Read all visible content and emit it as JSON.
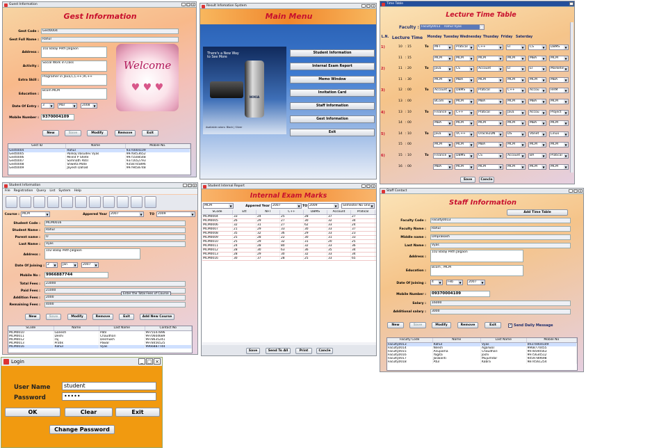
{
  "guest": {
    "window_title": "Guest Information",
    "title": "Gest Information",
    "labels": {
      "code": "Gest Code :",
      "name": "Gest Full Name :",
      "address": "Address :",
      "activity": "Activity :",
      "extra_skill": "Extra Skill :",
      "education": "Education :",
      "date_of_entry": "Date Of Entry :",
      "mobile": "Mobile Number :"
    },
    "values": {
      "code": "Gest0004",
      "name": "Rahul",
      "address": "102 Balaji Peth Jalgaon",
      "activity": "Social Work in Class",
      "extra_skill": "Programer in Java,C,C++,VC++",
      "education": "Bcom MCM",
      "day": "3",
      "month": "Mar",
      "year": "2008",
      "mobile": "9370004109"
    },
    "welcome_text": "Welcome",
    "buttons": {
      "new": "New",
      "save": "Save",
      "modify": "Modify",
      "remove": "Remove",
      "exit": "Exit"
    },
    "table": {
      "headers": [
        "Gest ID",
        "Name",
        "Mobile No."
      ],
      "rows": [
        [
          "Gest0004",
          "Rahul",
          "9370004109"
        ],
        [
          "Gest0005",
          "Pankaj Vasudev Vyas",
          "9976453652"
        ],
        [
          "Gest0006",
          "Milind P Shete",
          "9975508548"
        ],
        [
          "Gest0007",
          "Somnath Patil",
          "9371652793"
        ],
        [
          "Gest0008",
          "Shweta Mote",
          "9358745896"
        ],
        [
          "Gest0009",
          "Jayesh Dahad",
          "9979458748"
        ]
      ]
    }
  },
  "main_menu": {
    "window_title": "Result Infomation System",
    "title": "Main Menu",
    "phone_tagline": "There's a New Way\nto See More",
    "phone_caption": "Available colors: Black | Silver",
    "phone_brand": "NOKIA",
    "items": [
      "Student Information",
      "Internal Exam Report",
      "Memo Window",
      "Invitation Card",
      "Staff Information",
      "Gest Information",
      "Exit"
    ]
  },
  "timetable": {
    "window_title": "Time Table",
    "title": "Lecture Time Table",
    "faculty_label": "Faculty :",
    "faculty_value": "Faculty0013",
    "faculty_name": "Rahul Vyas",
    "headers": [
      "L.N.",
      "Lecture Time",
      "Monday",
      "Tuesday",
      "Wednesday",
      "Thusday",
      "Friday",
      "Saterday"
    ],
    "to": "To",
    "rows": [
      {
        "ln": "1)",
        "h": "10",
        "m": "15",
        "cells": [
          "MFT",
          "Pratical",
          "C++",
          "EI",
          "CS",
          "DBMS"
        ]
      },
      {
        "ln": "",
        "h": "11",
        "m": "15",
        "cells": [
          "MCM",
          "MCM",
          "MCM",
          "MCM",
          "MBA",
          "MCM"
        ]
      },
      {
        "ln": "2)",
        "h": "11",
        "m": "20",
        "cells": [
          "Java",
          "CS",
          "Account",
          "EI",
          "EI",
          "Marketing"
        ]
      },
      {
        "ln": "",
        "h": "11",
        "m": "30",
        "cells": [
          "MCM",
          "MBA",
          "MCM",
          "MCM",
          "MCM",
          "MBA"
        ]
      },
      {
        "ln": "3)",
        "h": "12",
        "m": "00",
        "cells": [
          "Account",
          "DBMS",
          "Pratical",
          "C++",
          "Accou",
          "HRM"
        ]
      },
      {
        "ln": "",
        "h": "13",
        "m": "00",
        "cells": [
          "BCom",
          "MCM",
          "MBA",
          "MCM",
          "MBA",
          "MCM"
        ]
      },
      {
        "ln": "4)",
        "h": "13",
        "m": "10",
        "cells": [
          "Finance",
          "C++",
          "Pratical",
          "Java",
          "Accou",
          "Project"
        ]
      },
      {
        "ln": "",
        "h": "14",
        "m": "00",
        "cells": [
          "MBA",
          "MCM",
          "MCM",
          "MCM",
          "MBA",
          "MCM"
        ]
      },
      {
        "ln": "5)",
        "h": "14",
        "m": "10",
        "cells": [
          "Java",
          "VC++",
          "Oracle2DN",
          "DS",
          "Vbnet",
          "Linux"
        ]
      },
      {
        "ln": "",
        "h": "15",
        "m": "00",
        "cells": [
          "MCM",
          "MCM",
          "MBA",
          "MCM",
          "MCM",
          "MCM"
        ]
      },
      {
        "ln": "6)",
        "h": "15",
        "m": "10",
        "cells": [
          "Finance",
          "DBMS",
          "CS",
          "Account",
          "BA",
          "Pratical"
        ]
      },
      {
        "ln": "",
        "h": "16",
        "m": "00",
        "cells": [
          "MBA",
          "MCM",
          "MCM",
          "MCM",
          "MCM",
          "MCM"
        ]
      }
    ],
    "buttons": {
      "save": "Save",
      "cancel": "Cancle"
    }
  },
  "student": {
    "window_title": "Student Information",
    "menu": [
      "File",
      "Registration",
      "Query",
      "List",
      "System",
      "Help"
    ],
    "labels": {
      "course": "Course :",
      "appeared": "Appered Year",
      "to": "TO",
      "code": "Student Code :",
      "name": "Student Name :",
      "parent": "Parent name :",
      "last": "Last Name :",
      "address": "Address :",
      "doj": "Date Of Joining :",
      "mobile": "Mobile No :",
      "total": "Total Fees :",
      "paid": "Paid Fees :",
      "addition": "Addition Fees :",
      "remaining": "Remaining Fees :"
    },
    "values": {
      "course": "MCM",
      "from": "2007",
      "to": "2009",
      "code": "MCM0016",
      "name": "Rahul",
      "parent": "O",
      "last": "Vyas",
      "address": "102 Balaji Peth Jalgaon",
      "day": "2",
      "month": "Jan",
      "year": "2007",
      "mobile": "9966887744",
      "total": "23000",
      "paid": "21000",
      "addition": "2000",
      "remaining": "4000"
    },
    "tooltip": "Enter the Total Fees of Course",
    "buttons": {
      "new": "New",
      "save": "Save",
      "modify": "Modify",
      "remove": "Remove",
      "exit": "Exit",
      "add_course": "Add New Course"
    },
    "table": {
      "headers": [
        "SCode",
        "Name",
        "Last Name",
        "Contact No"
      ],
      "rows": [
        [
          "MCM0010",
          "Ganesh",
          "Patil",
          "9975547896"
        ],
        [
          "MCM0011",
          "Deshi",
          "Chaudhari",
          "9970604689"
        ],
        [
          "MCM0012",
          "raj",
          "Desmukh",
          "9978635241"
        ],
        [
          "MCM0013",
          "Pratik",
          "Pawar",
          "9978456525"
        ],
        [
          "MCM0016",
          "Rahul",
          "Vyas",
          "9966887744"
        ]
      ]
    }
  },
  "exam": {
    "window_title": "Student Internal Report",
    "title": "Internal Exam Marks",
    "course": "MCM",
    "appeared_label": "Appered Year",
    "from": "2007",
    "to_label": "TO",
    "to": "2009",
    "semester": "Semester No One",
    "headers": [
      "SCode",
      "Ett",
      "NFT",
      "C++",
      "DBMS",
      "Account",
      "Pratical"
    ],
    "rows": [
      [
        "MCM0004",
        "33",
        "24",
        "25",
        "28",
        "37",
        "27"
      ],
      [
        "MCM0005",
        "26",
        "29",
        "27",
        "30",
        "32",
        "34"
      ],
      [
        "MCM0006",
        "32",
        "31",
        "27",
        "62",
        "33",
        "24"
      ],
      [
        "MCM0007",
        "21",
        "29",
        "33",
        "30",
        "33",
        "37"
      ],
      [
        "MCM0008",
        "35",
        "32",
        "36",
        "29",
        "33",
        "23"
      ],
      [
        "MCM0009",
        "25",
        "28",
        "22",
        "30",
        "31",
        "33"
      ],
      [
        "MCM0010",
        "25",
        "29",
        "32",
        "31",
        "20",
        "25"
      ],
      [
        "MCM0011",
        "24",
        "28",
        "80",
        "32",
        "33",
        "36"
      ],
      [
        "MCM0012",
        "28",
        "30",
        "63",
        "36",
        "35",
        "34"
      ],
      [
        "MCM0013",
        "28",
        "29",
        "30",
        "32",
        "33",
        "34"
      ],
      [
        "MCM0016",
        "30",
        "37",
        "28",
        "25",
        "33",
        "65"
      ]
    ],
    "buttons": {
      "save": "Save",
      "send": "Send To All",
      "print": "Print",
      "cancel": "Cancle"
    }
  },
  "staff": {
    "window_title": "Staff Contact",
    "title": "Staff Information",
    "add_tt": "Add Time Table",
    "labels": {
      "code": "Faculty Code :",
      "name": "Faculty Name :",
      "middle": "Middle name :",
      "last": "Last Name :",
      "address": "Address :",
      "education": "Education :",
      "doj": "Date Of Joining :",
      "mobile": "Mobile Number :",
      "salary": "Salary :",
      "additional": "Additional salary :"
    },
    "values": {
      "code": "Faculty0013",
      "name": "Rahul",
      "middle": "Omprakash",
      "last": "Vyas",
      "address": "102 Balaji Peth Jalgaon",
      "education": "Bcom , MCM",
      "day": "4",
      "month": "Feb",
      "year": "2007",
      "mobile": "09370004109",
      "salary": "16000",
      "additional": "3000"
    },
    "buttons": {
      "new": "New",
      "save": "Save",
      "modify": "Modify",
      "remove": "Remove",
      "exit": "Exit"
    },
    "send_daily": "Send Daily Message",
    "table": {
      "headers": [
        "Faculty Code",
        "Name",
        "Last Name",
        "Mobile No"
      ],
      "rows": [
        [
          "Faculty0013",
          "Rahul",
          "Vyas",
          "09370004109"
        ],
        [
          "Faculty0014",
          "Nilesh",
          "Agarwal",
          "9968774455"
        ],
        [
          "Faculty0015",
          "Anupama",
          "Chaudhari",
          "9978594563"
        ],
        [
          "Faculty0016",
          "Yogita",
          "Joshi",
          "9975634512"
        ],
        [
          "Faculty0017",
          "Jaswanti",
          "Mujumdar",
          "9459789698"
        ],
        [
          "Faculty0018",
          "Atul",
          "Kabra",
          "9874561254"
        ]
      ]
    }
  },
  "login": {
    "window_title": "Login",
    "username_label": "User Name",
    "password_label": "Password",
    "username": "student",
    "password": "•••••",
    "ok": "OK",
    "clear": "Clear",
    "exit": "Exit",
    "change": "Change Password"
  },
  "colors": {
    "title_red": "#c8102e",
    "login_orange": "#f19a10",
    "menu_blue": "#2f6ec8"
  }
}
